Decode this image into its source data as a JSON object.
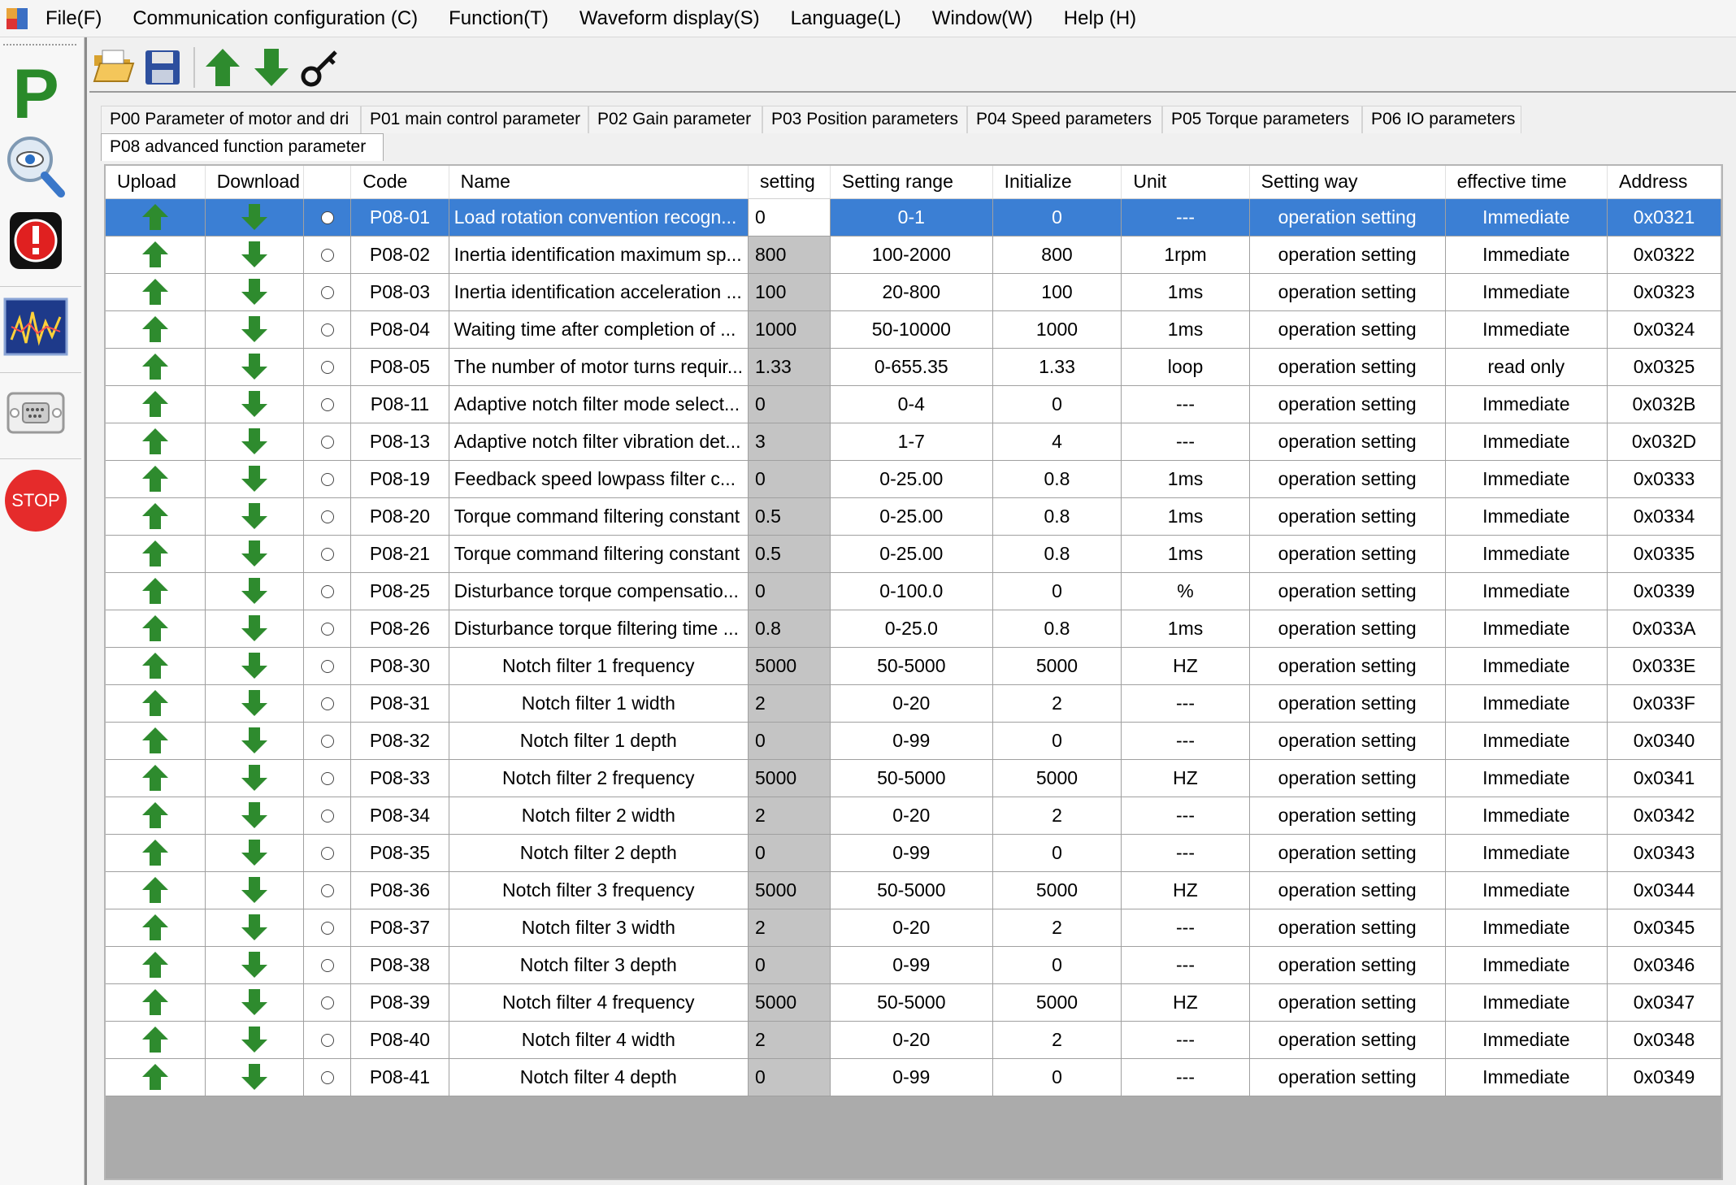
{
  "menu": [
    "File(F)",
    "Communication configuration (C)",
    "Function(T)",
    "Waveform display(S)",
    "Language(L)",
    "Window(W)",
    "Help (H)"
  ],
  "sidebar": {
    "p_label": "P",
    "stop_label": "STOP"
  },
  "tabs_row1": [
    "P00  Parameter of motor and dri",
    "P01 main control parameter",
    "P02 Gain parameter",
    "P03 Position parameters",
    "P04 Speed parameters",
    "P05 Torque parameters",
    "P06 IO parameters"
  ],
  "tabs_row2": [
    "P08 advanced function parameter"
  ],
  "columns": [
    "Upload",
    "Download",
    "",
    "Code",
    "Name",
    "setting",
    "Setting range",
    "Initialize",
    "Unit",
    "Setting way",
    "effective time",
    "Address"
  ],
  "rows": [
    {
      "code": "P08-01",
      "name": "Load rotation convention recogn...",
      "setting": "0",
      "range": "0-1",
      "init": "0",
      "unit": "---",
      "way": "operation setting",
      "time": "Immediate",
      "addr": "0x0321"
    },
    {
      "code": "P08-02",
      "name": "Inertia identification maximum sp...",
      "setting": "800",
      "range": "100-2000",
      "init": "800",
      "unit": "1rpm",
      "way": "operation setting",
      "time": "Immediate",
      "addr": "0x0322"
    },
    {
      "code": "P08-03",
      "name": "Inertia identification acceleration ...",
      "setting": "100",
      "range": "20-800",
      "init": "100",
      "unit": "1ms",
      "way": "operation setting",
      "time": "Immediate",
      "addr": "0x0323"
    },
    {
      "code": "P08-04",
      "name": "Waiting time after completion of ...",
      "setting": "1000",
      "range": "50-10000",
      "init": "1000",
      "unit": "1ms",
      "way": "operation setting",
      "time": "Immediate",
      "addr": "0x0324"
    },
    {
      "code": "P08-05",
      "name": "The number of motor turns requir...",
      "setting": "1.33",
      "range": "0-655.35",
      "init": "1.33",
      "unit": "loop",
      "way": "operation setting",
      "time": "read only",
      "addr": "0x0325"
    },
    {
      "code": "P08-11",
      "name": "Adaptive notch filter mode select...",
      "setting": "0",
      "range": "0-4",
      "init": "0",
      "unit": "---",
      "way": "operation setting",
      "time": "Immediate",
      "addr": "0x032B"
    },
    {
      "code": "P08-13",
      "name": "Adaptive notch filter vibration det...",
      "setting": "3",
      "range": "1-7",
      "init": "4",
      "unit": "---",
      "way": "operation setting",
      "time": "Immediate",
      "addr": "0x032D"
    },
    {
      "code": "P08-19",
      "name": "Feedback speed lowpass filter c...",
      "setting": "0",
      "range": "0-25.00",
      "init": "0.8",
      "unit": "1ms",
      "way": "operation setting",
      "time": "Immediate",
      "addr": "0x0333"
    },
    {
      "code": "P08-20",
      "name": "Torque command filtering constant",
      "setting": "0.5",
      "range": "0-25.00",
      "init": "0.8",
      "unit": "1ms",
      "way": "operation setting",
      "time": "Immediate",
      "addr": "0x0334"
    },
    {
      "code": "P08-21",
      "name": "Torque command filtering constant",
      "setting": "0.5",
      "range": "0-25.00",
      "init": "0.8",
      "unit": "1ms",
      "way": "operation setting",
      "time": "Immediate",
      "addr": "0x0335"
    },
    {
      "code": "P08-25",
      "name": "Disturbance torque compensatio...",
      "setting": "0",
      "range": "0-100.0",
      "init": "0",
      "unit": "%",
      "way": "operation setting",
      "time": "Immediate",
      "addr": "0x0339"
    },
    {
      "code": "P08-26",
      "name": "Disturbance torque filtering time ...",
      "setting": "0.8",
      "range": "0-25.0",
      "init": "0.8",
      "unit": "1ms",
      "way": "operation setting",
      "time": "Immediate",
      "addr": "0x033A"
    },
    {
      "code": "P08-30",
      "name": "Notch filter 1 frequency",
      "setting": "5000",
      "range": "50-5000",
      "init": "5000",
      "unit": "HZ",
      "way": "operation setting",
      "time": "Immediate",
      "addr": "0x033E"
    },
    {
      "code": "P08-31",
      "name": "Notch filter 1 width",
      "setting": "2",
      "range": "0-20",
      "init": "2",
      "unit": "---",
      "way": "operation setting",
      "time": "Immediate",
      "addr": "0x033F"
    },
    {
      "code": "P08-32",
      "name": "Notch filter 1 depth",
      "setting": "0",
      "range": "0-99",
      "init": "0",
      "unit": "---",
      "way": "operation setting",
      "time": "Immediate",
      "addr": "0x0340"
    },
    {
      "code": "P08-33",
      "name": "Notch filter 2 frequency",
      "setting": "5000",
      "range": "50-5000",
      "init": "5000",
      "unit": "HZ",
      "way": "operation setting",
      "time": "Immediate",
      "addr": "0x0341"
    },
    {
      "code": "P08-34",
      "name": "Notch filter 2 width",
      "setting": "2",
      "range": "0-20",
      "init": "2",
      "unit": "---",
      "way": "operation setting",
      "time": "Immediate",
      "addr": "0x0342"
    },
    {
      "code": "P08-35",
      "name": "Notch filter 2 depth",
      "setting": "0",
      "range": "0-99",
      "init": "0",
      "unit": "---",
      "way": "operation setting",
      "time": "Immediate",
      "addr": "0x0343"
    },
    {
      "code": "P08-36",
      "name": "Notch filter 3 frequency",
      "setting": "5000",
      "range": "50-5000",
      "init": "5000",
      "unit": "HZ",
      "way": "operation setting",
      "time": "Immediate",
      "addr": "0x0344"
    },
    {
      "code": "P08-37",
      "name": "Notch filter 3 width",
      "setting": "2",
      "range": "0-20",
      "init": "2",
      "unit": "---",
      "way": "operation setting",
      "time": "Immediate",
      "addr": "0x0345"
    },
    {
      "code": "P08-38",
      "name": "Notch filter 3 depth",
      "setting": "0",
      "range": "0-99",
      "init": "0",
      "unit": "---",
      "way": "operation setting",
      "time": "Immediate",
      "addr": "0x0346"
    },
    {
      "code": "P08-39",
      "name": "Notch filter 4 frequency",
      "setting": "5000",
      "range": "50-5000",
      "init": "5000",
      "unit": "HZ",
      "way": "operation setting",
      "time": "Immediate",
      "addr": "0x0347"
    },
    {
      "code": "P08-40",
      "name": "Notch filter 4 width",
      "setting": "2",
      "range": "0-20",
      "init": "2",
      "unit": "---",
      "way": "operation setting",
      "time": "Immediate",
      "addr": "0x0348"
    },
    {
      "code": "P08-41",
      "name": "Notch filter 4 depth",
      "setting": "0",
      "range": "0-99",
      "init": "0",
      "unit": "---",
      "way": "operation setting",
      "time": "Immediate",
      "addr": "0x0349"
    }
  ],
  "colors": {
    "arrow_green": "#2e8b2e",
    "selected_row": "#3b7fd4",
    "setting_cell": "#c4c4c4"
  }
}
